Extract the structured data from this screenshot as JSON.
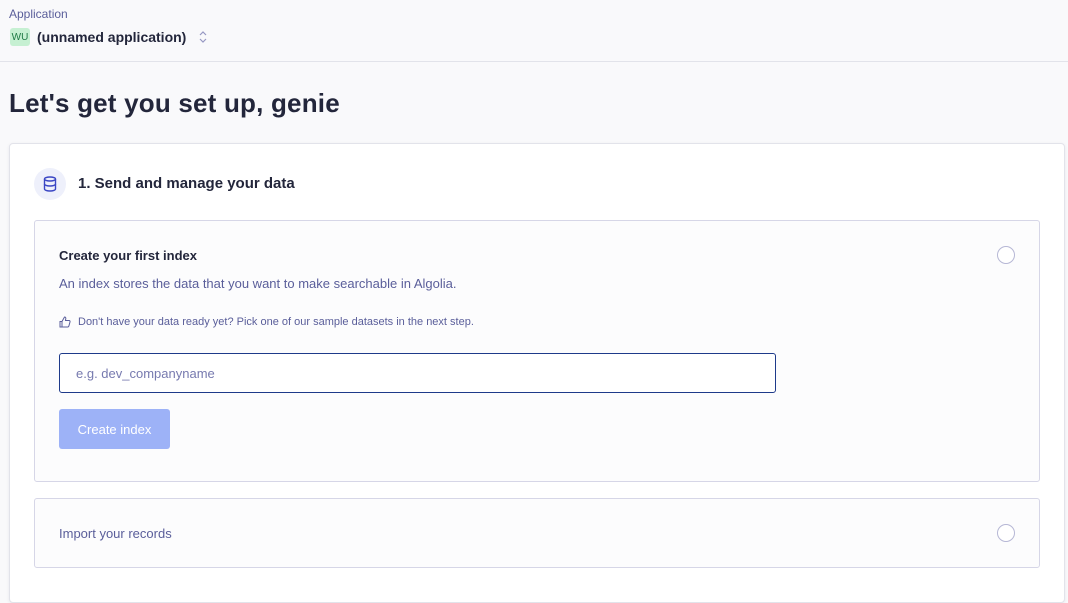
{
  "header": {
    "label": "Application",
    "app_badge": "WU",
    "app_name": "(unnamed application)"
  },
  "page": {
    "title": "Let's get you set up, genie"
  },
  "section": {
    "title": "1. Send and manage your data",
    "icon": "database-icon"
  },
  "create_index": {
    "title": "Create your first index",
    "description": "An index stores the data that you want to make searchable in Algolia.",
    "tip": "Don't have your data ready yet? Pick one of our sample datasets in the next step.",
    "tip_icon": "thumbs-up-icon",
    "input_value": "",
    "input_placeholder": "e.g. dev_companyname",
    "button_label": "Create index",
    "button_disabled": true
  },
  "import_records": {
    "title": "Import your records"
  },
  "colors": {
    "accent": "#1e3a8a",
    "button_disabled": "#9db2f7",
    "muted_text": "#5a5e9a",
    "badge_bg": "#c6f0d2"
  }
}
